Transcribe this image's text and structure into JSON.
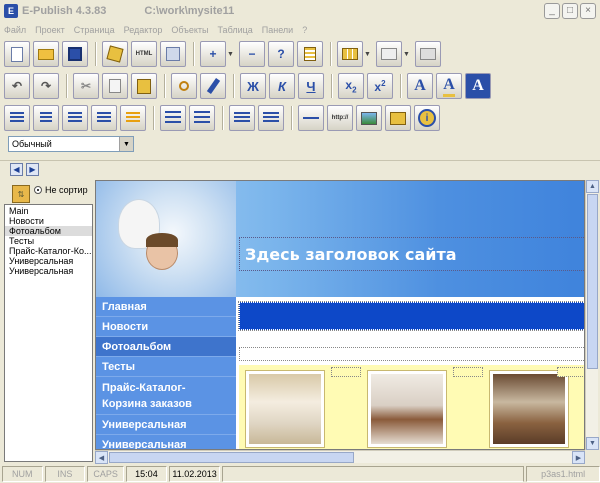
{
  "window": {
    "app_title": "E-Publish 4.3.83",
    "path": "C:\\work\\mysite11",
    "minimize": "_",
    "maximize": "□",
    "close": "×"
  },
  "menu": [
    "Файл",
    "Проект",
    "Страница",
    "Редактор",
    "Объекты",
    "Таблица",
    "Панели",
    "?"
  ],
  "toolbar": {
    "bold": "Ж",
    "italic": "К",
    "underline": "Ч",
    "subscript": "x",
    "subscript_index": "2",
    "superscript": "x",
    "superscript_index": "2",
    "font_color": "A",
    "highlight": "A",
    "font_style": "A",
    "html_label": "HTML",
    "http_label": "http://",
    "help": "?"
  },
  "style_select": {
    "value": "Обычный"
  },
  "left_panel": {
    "sort_radio": "Не сортир",
    "pages": [
      "Main",
      "Новости",
      "Фотоальбом",
      "Тесты",
      "Прайс-Каталог-Ко...",
      "Универсальная",
      "Универсальная"
    ],
    "selected_index": 2
  },
  "site": {
    "header_title": "Здесь заголовок сайта",
    "nav": [
      {
        "label": "Главная"
      },
      {
        "label": "Новости"
      },
      {
        "label": "Фотоальбом",
        "selected": true
      },
      {
        "label": "Тесты"
      },
      {
        "label": "Прайс-Каталог-\nКорзина заказов"
      },
      {
        "label": "Универсальная"
      },
      {
        "label": "Универсальная"
      }
    ],
    "banner_colors": [
      "#a8d0f4",
      "#3f83dc"
    ],
    "nav_color": "#5b93e4",
    "gallery_bg": "#fffbb4",
    "header_bar_color": "#0d48c8"
  },
  "status": {
    "num": "NUM",
    "ins": "INS",
    "caps": "CAPS",
    "time": "15:04",
    "date": "11.02.2013",
    "file": "p3as1.html"
  }
}
